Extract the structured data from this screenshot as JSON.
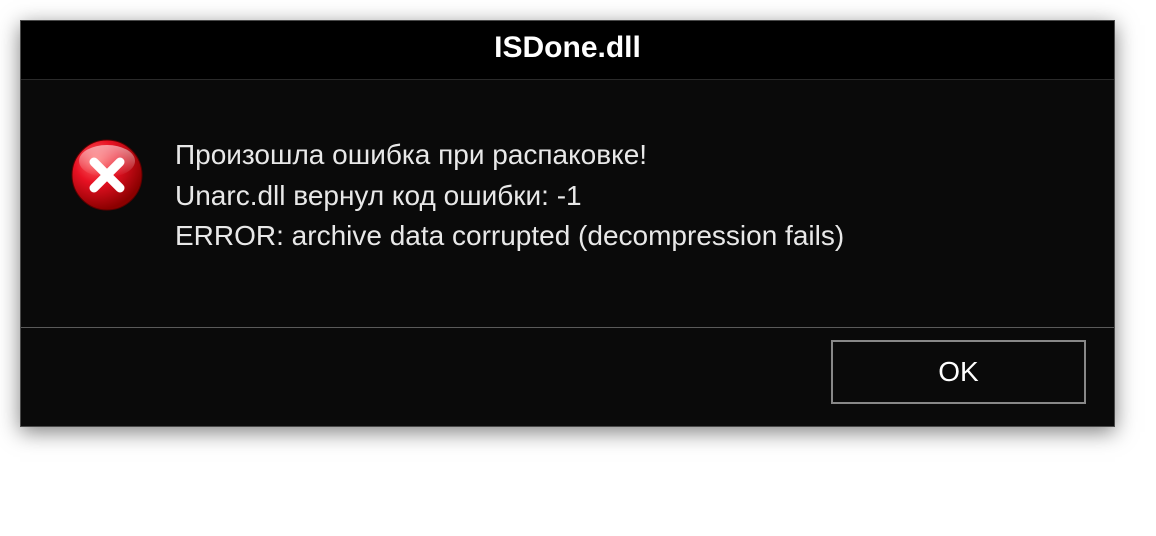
{
  "dialog": {
    "title": "ISDone.dll",
    "icon": "error-icon",
    "message": {
      "line1": "Произошла ошибка при распаковке!",
      "line2": "Unarc.dll вернул код ошибки: -1",
      "line3": "ERROR: archive data corrupted (decompression fails)"
    },
    "buttons": {
      "ok_label": "OK"
    }
  }
}
